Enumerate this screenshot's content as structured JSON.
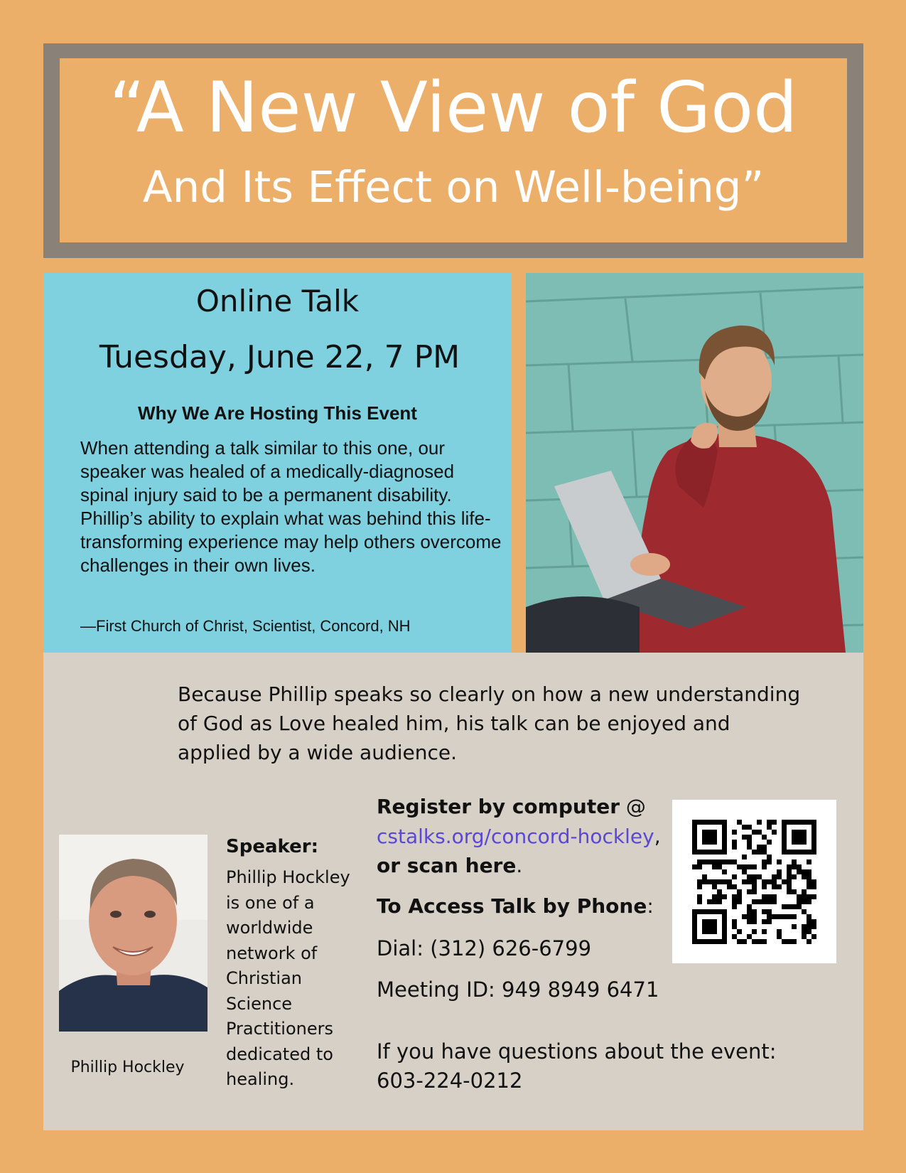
{
  "title": {
    "line1": "“A New View of God",
    "line2": "And Its Effect on Well-being”"
  },
  "event": {
    "kind": "Online Talk",
    "date": "Tuesday, June 22, 7 PM"
  },
  "why": {
    "heading": "Why We Are Hosting This Event",
    "body": "When attending a talk similar to this one, our speaker was healed of a medically-diagnosed spinal injury said to be a permanent disability. Phillip’s ability to explain what was behind this life-transforming experience may help others overcome challenges in their own lives.",
    "attribution": "—First Church of Christ, Scientist, Concord, NH"
  },
  "intro": "Because Phillip speaks so clearly on how a new understanding of God as Love healed him, his talk can be enjoyed and applied by a wide audience.",
  "speaker": {
    "heading": "Speaker:",
    "bio": "Phillip Hockley is one of a worldwide network of Christian Science Practitioners dedicated to healing.",
    "caption": "Phillip Hockley"
  },
  "register": {
    "label": "Register by computer",
    "at": " @",
    "link": "cstalks.org/concord-hockley",
    "comma": ",",
    "scan": " or scan here",
    "period": "."
  },
  "phone": {
    "heading": "To Access Talk by Phone",
    "colon": ":",
    "dial": "Dial: (312) 626-6799",
    "meeting": "Meeting ID: 949 8949 6471"
  },
  "questions": {
    "label": "If you have questions about the event:",
    "number": "603-224-0212"
  },
  "colors": {
    "background": "#ecaf6a",
    "frame": "#8a8178",
    "info_panel": "#7fd1df",
    "lower_panel": "#d6d0c7",
    "link": "#5a47d6"
  },
  "icons": {
    "main_photo": "man-with-laptop-photo",
    "speaker_photo": "speaker-portrait-photo",
    "qr": "qr-code-icon"
  }
}
